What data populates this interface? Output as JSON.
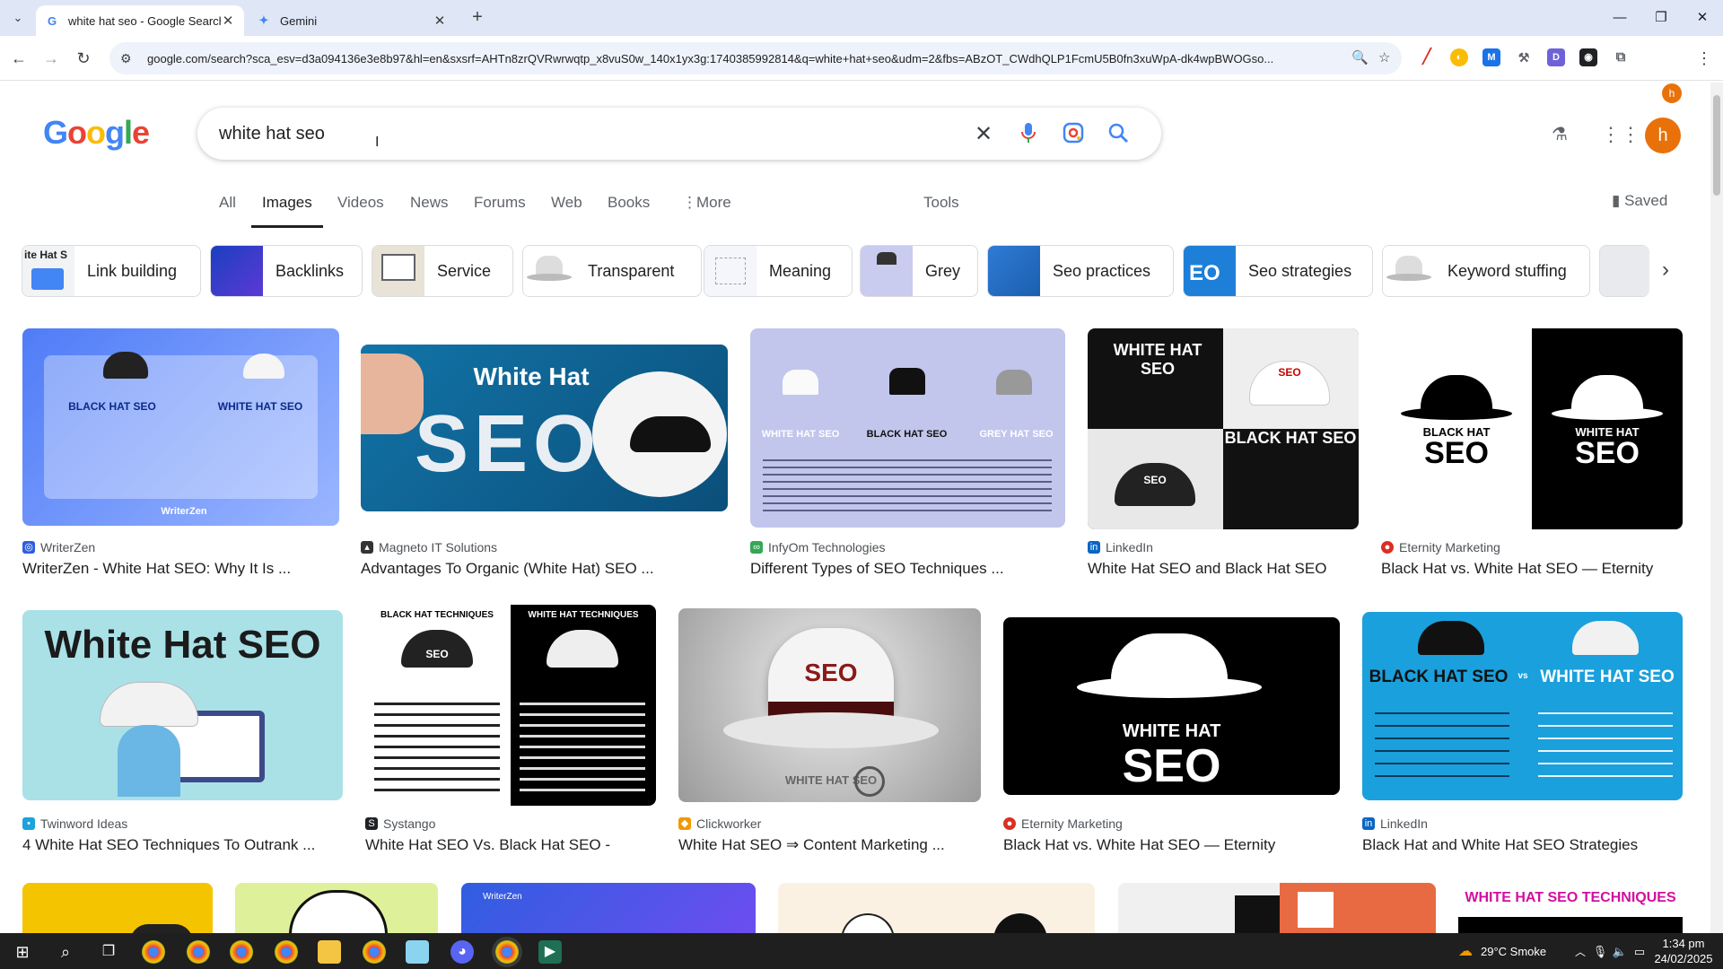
{
  "browser": {
    "tabs": [
      {
        "title": "white hat seo - Google Search",
        "favicon": "google-g-icon",
        "active": true
      },
      {
        "title": "Gemini",
        "favicon": "gemini-spark-icon",
        "active": false
      }
    ],
    "url": "google.com/search?sca_esv=d3a094136e3e8b97&hl=en&sxsrf=AHTn8zrQVRwrwqtp_x8vuS0w_140x1yx3g:1740385992814&q=white+hat+seo&udm=2&fbs=ABzOT_CWdhQLP1FcmU5B0fn3xuWpA-dk4wpBWOGso...",
    "profile_initial": "h"
  },
  "google": {
    "logo": [
      "G",
      "o",
      "o",
      "g",
      "l",
      "e"
    ],
    "logo_colors": [
      "#4285f4",
      "#ea4335",
      "#fbbc05",
      "#4285f4",
      "#34a853",
      "#ea4335"
    ],
    "query": "white hat seo",
    "avatar_initial": "h"
  },
  "nav": {
    "tabs": [
      "All",
      "Images",
      "Videos",
      "News",
      "Forums",
      "Web",
      "Books",
      "More"
    ],
    "tools": "Tools",
    "saved": "Saved"
  },
  "chips": [
    "Link building",
    "Backlinks",
    "Service",
    "Transparent",
    "Meaning",
    "Grey",
    "Seo practices",
    "Seo strategies",
    "Keyword stuffing"
  ],
  "chip_thumb_text": {
    "link_building": "ite Hat S",
    "seo_practices": "",
    "seo_strategies": "EO"
  },
  "results": [
    {
      "source": "WriterZen",
      "caption": "WriterZen - White Hat SEO: Why It Is ...",
      "img_text": [
        "BLACK HAT SEO",
        "WHITE HAT SEO",
        "WriterZen"
      ]
    },
    {
      "source": "Magneto IT Solutions",
      "caption": "Advantages To Organic (White Hat) SEO ...",
      "img_text": [
        "White Hat",
        "SEO"
      ]
    },
    {
      "source": "InfyOm Technologies",
      "caption": "Different Types of SEO Techniques ...",
      "img_text": [
        "WHITE HAT SEO",
        "BLACK HAT SEO",
        "GREY HAT SEO"
      ]
    },
    {
      "source": "LinkedIn",
      "caption": "White Hat SEO and Black Hat SEO",
      "img_text": [
        "WHITE HAT SEO",
        "BLACK HAT SEO",
        "SEO",
        "SEO"
      ]
    },
    {
      "source": "Eternity Marketing",
      "caption": "Black Hat vs. White Hat SEO — Eternity",
      "img_text": [
        "BLACK HAT",
        "SEO",
        "WHITE HAT",
        "SEO"
      ]
    },
    {
      "source": "Twinword Ideas",
      "caption": "4 White Hat SEO Techniques To Outrank ...",
      "img_text": [
        "White Hat SEO"
      ]
    },
    {
      "source": "Systango",
      "caption": "White Hat SEO Vs. Black Hat SEO -",
      "img_text": [
        "BLACK HAT TECHNIQUES",
        "WHITE HAT TECHNIQUES",
        "SEO"
      ]
    },
    {
      "source": "Clickworker",
      "caption": "White Hat SEO ⇒ Content Marketing ...",
      "img_text": [
        "SEO",
        "WHITE HAT SEO"
      ]
    },
    {
      "source": "Eternity Marketing",
      "caption": "Black Hat vs. White Hat SEO — Eternity",
      "img_text": [
        "WHITE HAT",
        "SEO"
      ]
    },
    {
      "source": "LinkedIn",
      "caption": "Black Hat and White Hat SEO Strategies",
      "img_text": [
        "BLACK HAT SEO",
        "vs",
        "WHITE HAT SEO"
      ]
    }
  ],
  "partial_row": {
    "last_caption": "WHITE HAT SEO TECHNIQUES",
    "writerzen": "WriterZen"
  },
  "taskbar": {
    "weather": "29°C  Smoke",
    "time": "1:34 pm",
    "date": "24/02/2025"
  }
}
